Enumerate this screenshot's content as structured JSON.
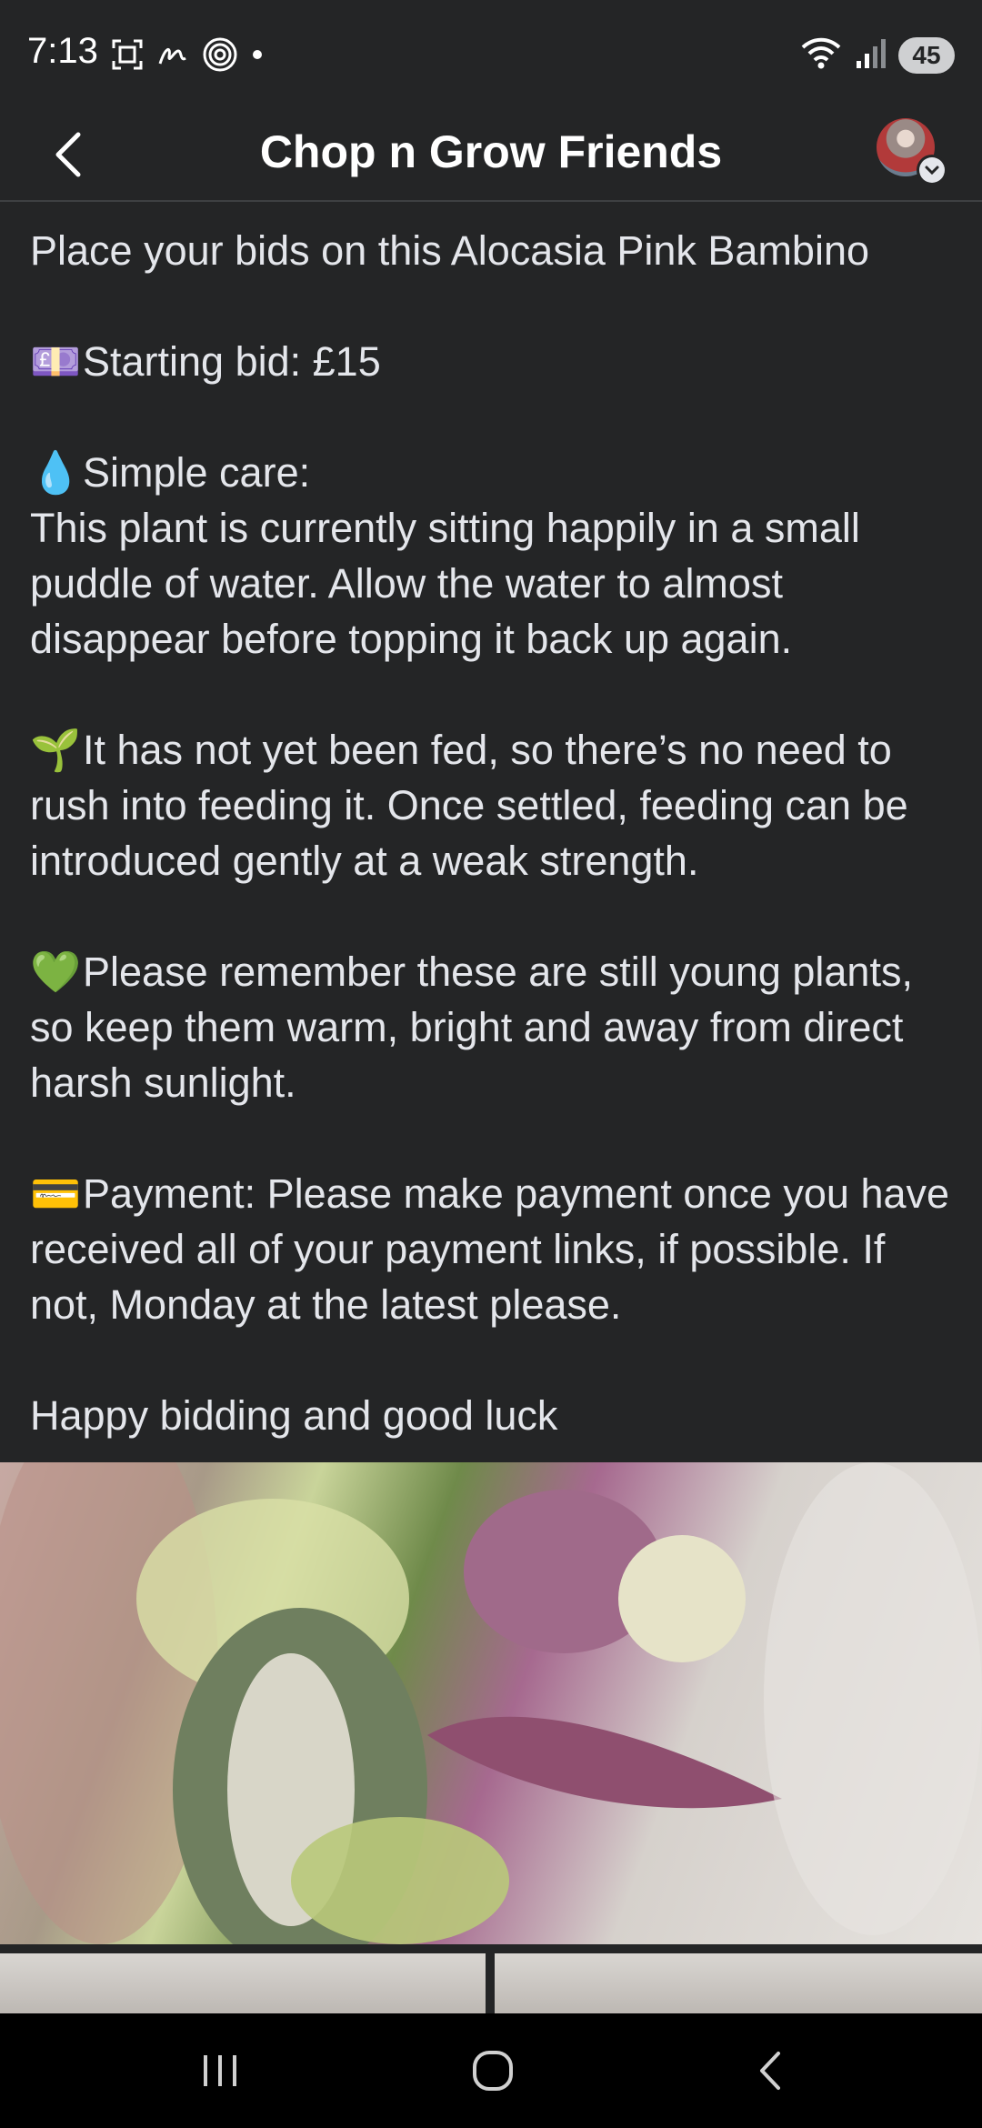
{
  "status_bar": {
    "time": "7:13",
    "battery": "45",
    "left_icons": [
      "screenshot-icon",
      "signature-icon",
      "fingerprint-icon",
      "dot-icon"
    ],
    "right_icons": [
      "wifi-icon",
      "signal-icon",
      "battery-icon"
    ]
  },
  "header": {
    "title": "Chop n Grow Friends",
    "back_icon": "chevron-left-icon",
    "avatar_badge_icon": "chevron-down-icon"
  },
  "post": {
    "line1": "Place your bids on this Alocasia Pink Bambino",
    "bid_emoji": "💷",
    "bid_text": "Starting bid: £15",
    "care_emoji": "💧",
    "care_title": "Simple care:",
    "care_text": "This plant is currently sitting happily in a small puddle of water. Allow the water to almost disappear before topping it back up again.",
    "feed_emoji": "🌱",
    "feed_text": "It has not yet been fed, so there’s no need to rush into feeding it. Once settled, feeding can be introduced gently at a weak strength.",
    "heart_emoji": "💚",
    "heart_text": "Please remember these are still young plants, so keep them warm, bright and away from direct harsh sunlight.",
    "pay_emoji": "💳",
    "pay_text": "Payment: Please make payment once you have received all of your payment links, if possible. If not, Monday at the latest please.",
    "closing": "Happy bidding and good luck"
  },
  "nav_bar": {
    "icons": [
      "recents-icon",
      "home-icon",
      "back-icon"
    ]
  },
  "colors": {
    "background": "#242526",
    "text": "#e4e6eb",
    "title": "#ffffff",
    "navbar": "#000000"
  }
}
